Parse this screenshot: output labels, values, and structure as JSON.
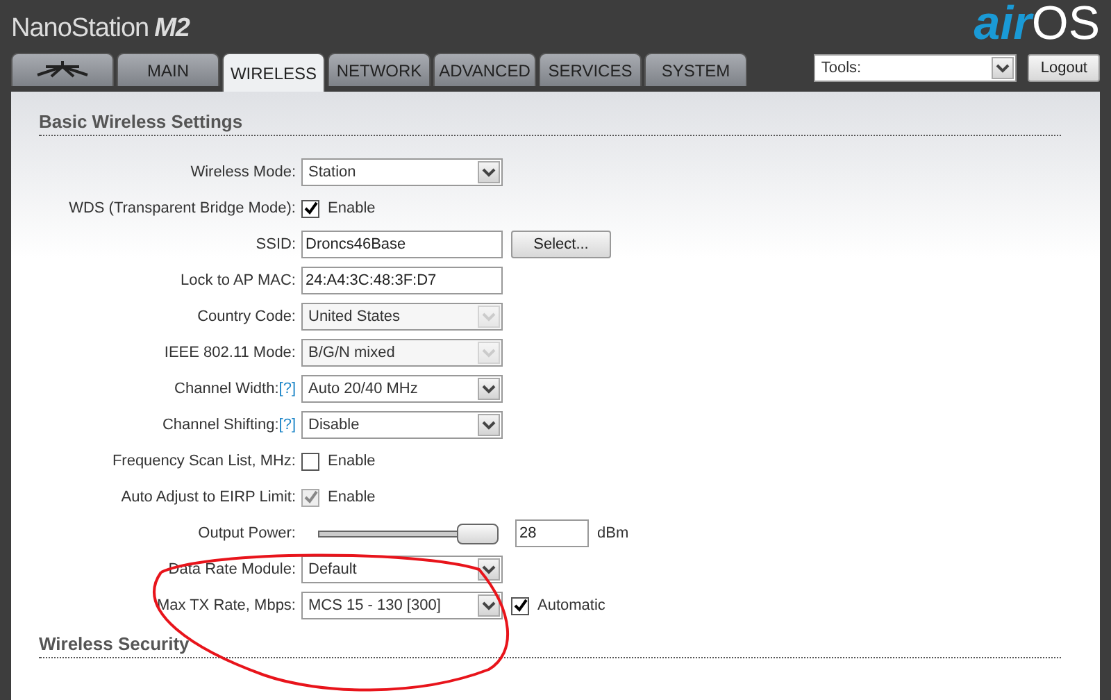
{
  "header": {
    "product": "NanoStation",
    "model": "M2",
    "logo_a": "air",
    "logo_b": "OS"
  },
  "tabs": [
    {
      "kind": "logo",
      "selected": false
    },
    {
      "label": "MAIN",
      "selected": false
    },
    {
      "label": "WIRELESS",
      "selected": true
    },
    {
      "label": "NETWORK",
      "selected": false
    },
    {
      "label": "ADVANCED",
      "selected": false
    },
    {
      "label": "SERVICES",
      "selected": false
    },
    {
      "label": "SYSTEM",
      "selected": false
    }
  ],
  "tools": {
    "value": "Tools:"
  },
  "logout": "Logout",
  "sections": [
    {
      "title": "Basic Wireless Settings",
      "rows": [
        {
          "kind": "select",
          "label": "Wireless Mode:",
          "value": "Station",
          "disabled": false
        },
        {
          "kind": "checkbox",
          "label": "WDS (Transparent Bridge Mode):",
          "checked": true,
          "disabled": false,
          "text": "Enable"
        },
        {
          "kind": "text",
          "label": "SSID:",
          "value": "Droncs46Base",
          "button": "Select..."
        },
        {
          "kind": "text",
          "label": "Lock to AP MAC:",
          "value": "24:A4:3C:48:3F:D7"
        },
        {
          "kind": "select",
          "label": "Country Code:",
          "value": "United States",
          "disabled": true
        },
        {
          "kind": "select",
          "label": "IEEE 802.11 Mode:",
          "value": "B/G/N mixed",
          "disabled": true
        },
        {
          "kind": "select",
          "label": "Channel Width:",
          "help": "[?]",
          "value": "Auto 20/40 MHz",
          "disabled": false
        },
        {
          "kind": "select",
          "label": "Channel Shifting:",
          "help": "[?]",
          "value": "Disable",
          "disabled": false
        },
        {
          "kind": "checkbox",
          "label": "Frequency Scan List, MHz:",
          "checked": false,
          "disabled": false,
          "text": "Enable"
        },
        {
          "kind": "checkbox",
          "label": "Auto Adjust to EIRP Limit:",
          "checked": true,
          "disabled": true,
          "text": "Enable"
        },
        {
          "kind": "slider",
          "label": "Output Power:",
          "level": 1,
          "value": "28",
          "unit": "dBm"
        },
        {
          "kind": "select",
          "label": "Data Rate Module:",
          "value": "Default",
          "disabled": false
        },
        {
          "kind": "select",
          "label": "Max TX Rate, Mbps:",
          "value": "MCS 15 - 130 [300]",
          "disabled": false,
          "check": {
            "checked": true,
            "text": "Automatic"
          }
        }
      ]
    },
    {
      "title": "Wireless Security"
    }
  ]
}
